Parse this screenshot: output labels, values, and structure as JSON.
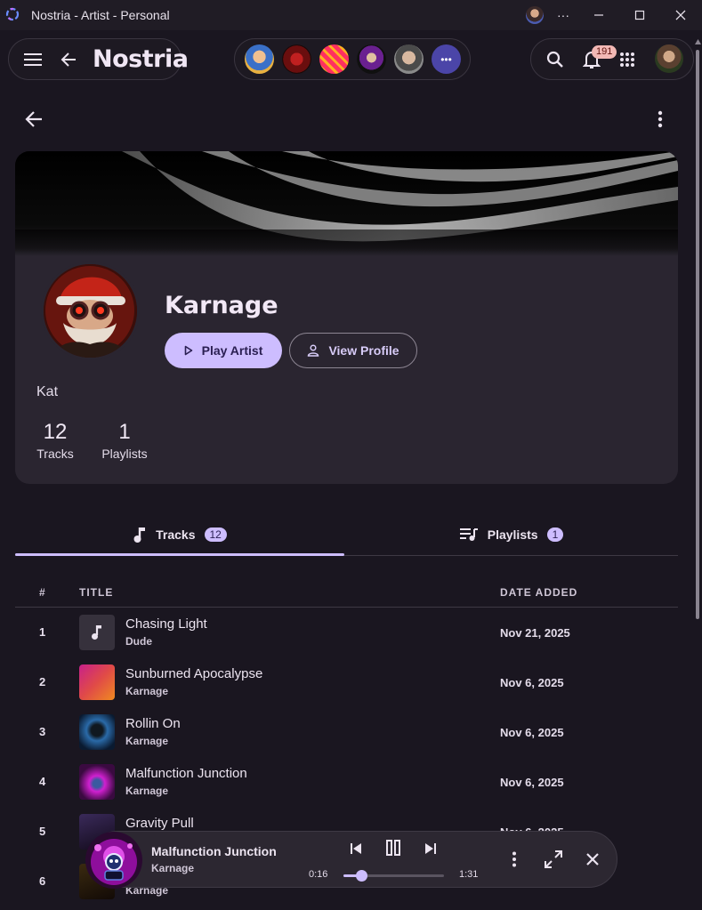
{
  "window": {
    "title": "Nostria - Artist - Personal",
    "more_label": "···"
  },
  "toolbar": {
    "brand": "Nostria",
    "notification_count": "191",
    "accounts_more_label": "•••"
  },
  "artist": {
    "name": "Karnage",
    "nickname": "Kat",
    "play_label": "Play Artist",
    "view_profile_label": "View Profile",
    "stats": [
      {
        "value": "12",
        "label": "Tracks"
      },
      {
        "value": "1",
        "label": "Playlists"
      }
    ]
  },
  "tabs": [
    {
      "label": "Tracks",
      "count": "12",
      "active": true
    },
    {
      "label": "Playlists",
      "count": "1",
      "active": false
    }
  ],
  "table": {
    "headers": {
      "num": "#",
      "title": "TITLE",
      "date": "DATE ADDED"
    },
    "rows": [
      {
        "num": "1",
        "title": "Chasing Light",
        "artist": "Dude",
        "date": "Nov 21, 2025",
        "cover": "music-note"
      },
      {
        "num": "2",
        "title": "Sunburned Apocalypse",
        "artist": "Karnage",
        "date": "Nov 6, 2025",
        "cover": "gradient"
      },
      {
        "num": "3",
        "title": "Rollin On",
        "artist": "Karnage",
        "date": "Nov 6, 2025",
        "cover": "sphere"
      },
      {
        "num": "4",
        "title": "Malfunction Junction",
        "artist": "Karnage",
        "date": "Nov 6, 2025",
        "cover": "robot"
      },
      {
        "num": "5",
        "title": "Gravity Pull",
        "artist": "",
        "date": "Nov 6, 2025",
        "cover": "dark"
      },
      {
        "num": "6",
        "title": "",
        "artist": "Karnage",
        "date": "",
        "cover": "dark"
      }
    ]
  },
  "player": {
    "title": "Malfunction Junction",
    "artist": "Karnage",
    "current_time": "0:16",
    "duration": "1:31",
    "progress": 0.18
  },
  "colors": {
    "accent": "#cdbdff",
    "background": "#1a1620",
    "card": "#2a2530",
    "badge": "#f2b8b5"
  }
}
